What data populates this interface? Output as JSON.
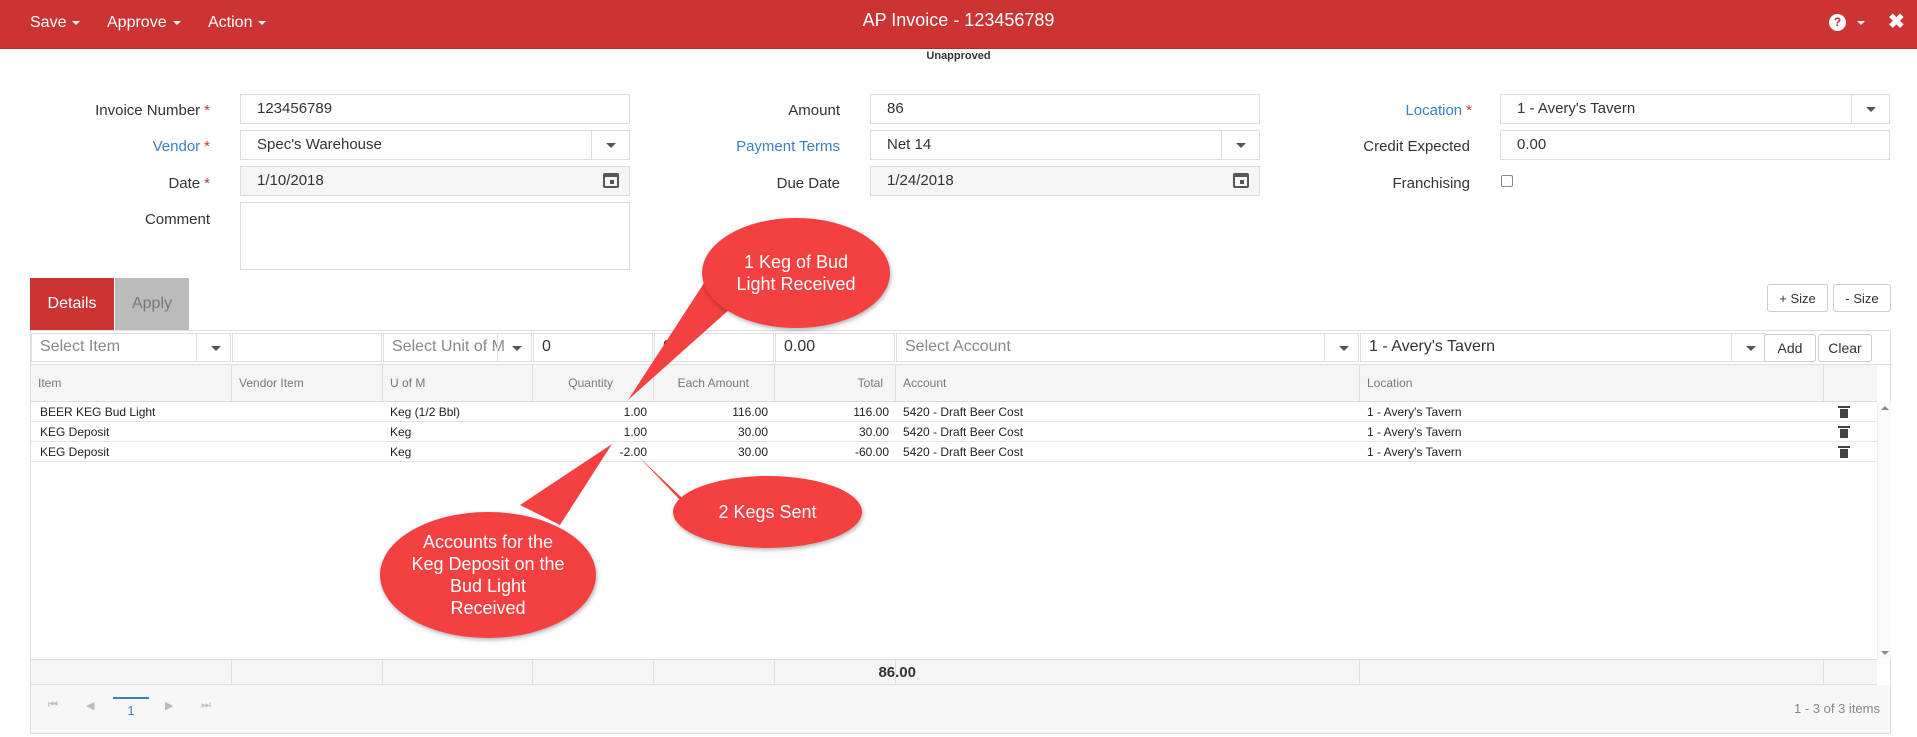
{
  "topbar": {
    "title": "AP Invoice - 123456789",
    "menus": [
      "Save",
      "Approve",
      "Action"
    ],
    "help_icon": "?",
    "close_icon": "✖",
    "status": "Unapproved"
  },
  "form": {
    "invoice_number_label": "Invoice Number",
    "invoice_number": "123456789",
    "vendor_label": "Vendor",
    "vendor": "Spec's Warehouse",
    "date_label": "Date",
    "date": "1/10/2018",
    "comment_label": "Comment",
    "comment": "",
    "amount_label": "Amount",
    "amount": "86",
    "payment_terms_label": "Payment Terms",
    "payment_terms": "Net 14",
    "due_date_label": "Due Date",
    "due_date": "1/24/2018",
    "location_label": "Location",
    "location": "1 - Avery's Tavern",
    "credit_expected_label": "Credit Expected",
    "credit_expected": "0.00",
    "franchising_label": "Franchising",
    "required_marker": "*"
  },
  "tabs": {
    "details": "Details",
    "apply": "Apply"
  },
  "size_buttons": {
    "plus": "+ Size",
    "minus": "- Size"
  },
  "entry": {
    "item_placeholder": "Select Item",
    "vendor_item": "",
    "uom_placeholder": "Select Unit of M",
    "quantity": "0",
    "each_amount": "0",
    "total": "0.00",
    "account_placeholder": "Select Account",
    "location": "1 - Avery's Tavern",
    "add_label": "Add",
    "clear_label": "Clear"
  },
  "columns": [
    "Item",
    "Vendor Item",
    "U of M",
    "Quantity",
    "Each Amount",
    "Total",
    "Account",
    "Location"
  ],
  "rows": [
    {
      "item": "BEER KEG Bud Light",
      "vendor_item": "",
      "uom": "Keg (1/2 Bbl)",
      "quantity": "1.00",
      "each": "116.00",
      "total": "116.00",
      "account": "5420 - Draft Beer Cost",
      "location": "1 - Avery's Tavern"
    },
    {
      "item": "KEG Deposit",
      "vendor_item": "",
      "uom": "Keg",
      "quantity": "1.00",
      "each": "30.00",
      "total": "30.00",
      "account": "5420 - Draft Beer Cost",
      "location": "1 - Avery's Tavern"
    },
    {
      "item": "KEG Deposit",
      "vendor_item": "",
      "uom": "Keg",
      "quantity": "-2.00",
      "each": "30.00",
      "total": "-60.00",
      "account": "5420 - Draft Beer Cost",
      "location": "1 - Avery's Tavern"
    }
  ],
  "footer_total": "86.00",
  "pager": {
    "first": "⏮",
    "prev": "◀",
    "page": "1",
    "next": "▶",
    "last": "⏭",
    "info": "1 - 3 of 3 items"
  },
  "callouts": {
    "received": "1 Keg of Bud Light Received",
    "sent": "2 Kegs Sent",
    "accounts": "Accounts for the Keg Deposit on the Bud Light Received"
  },
  "colors": {
    "brand": "#cc3333",
    "callout": "#f44040",
    "link": "#3a7fc1"
  }
}
